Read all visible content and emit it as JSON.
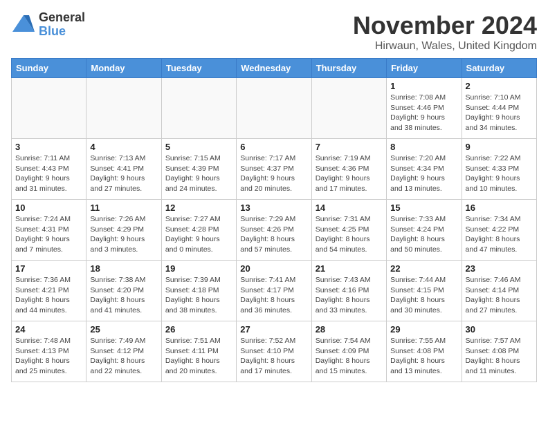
{
  "logo": {
    "general": "General",
    "blue": "Blue"
  },
  "title": "November 2024",
  "subtitle": "Hirwaun, Wales, United Kingdom",
  "days_of_week": [
    "Sunday",
    "Monday",
    "Tuesday",
    "Wednesday",
    "Thursday",
    "Friday",
    "Saturday"
  ],
  "weeks": [
    [
      {
        "day": "",
        "info": "",
        "empty": true
      },
      {
        "day": "",
        "info": "",
        "empty": true
      },
      {
        "day": "",
        "info": "",
        "empty": true
      },
      {
        "day": "",
        "info": "",
        "empty": true
      },
      {
        "day": "",
        "info": "",
        "empty": true
      },
      {
        "day": "1",
        "info": "Sunrise: 7:08 AM\nSunset: 4:46 PM\nDaylight: 9 hours and 38 minutes."
      },
      {
        "day": "2",
        "info": "Sunrise: 7:10 AM\nSunset: 4:44 PM\nDaylight: 9 hours and 34 minutes."
      }
    ],
    [
      {
        "day": "3",
        "info": "Sunrise: 7:11 AM\nSunset: 4:43 PM\nDaylight: 9 hours and 31 minutes."
      },
      {
        "day": "4",
        "info": "Sunrise: 7:13 AM\nSunset: 4:41 PM\nDaylight: 9 hours and 27 minutes."
      },
      {
        "day": "5",
        "info": "Sunrise: 7:15 AM\nSunset: 4:39 PM\nDaylight: 9 hours and 24 minutes."
      },
      {
        "day": "6",
        "info": "Sunrise: 7:17 AM\nSunset: 4:37 PM\nDaylight: 9 hours and 20 minutes."
      },
      {
        "day": "7",
        "info": "Sunrise: 7:19 AM\nSunset: 4:36 PM\nDaylight: 9 hours and 17 minutes."
      },
      {
        "day": "8",
        "info": "Sunrise: 7:20 AM\nSunset: 4:34 PM\nDaylight: 9 hours and 13 minutes."
      },
      {
        "day": "9",
        "info": "Sunrise: 7:22 AM\nSunset: 4:33 PM\nDaylight: 9 hours and 10 minutes."
      }
    ],
    [
      {
        "day": "10",
        "info": "Sunrise: 7:24 AM\nSunset: 4:31 PM\nDaylight: 9 hours and 7 minutes."
      },
      {
        "day": "11",
        "info": "Sunrise: 7:26 AM\nSunset: 4:29 PM\nDaylight: 9 hours and 3 minutes."
      },
      {
        "day": "12",
        "info": "Sunrise: 7:27 AM\nSunset: 4:28 PM\nDaylight: 9 hours and 0 minutes."
      },
      {
        "day": "13",
        "info": "Sunrise: 7:29 AM\nSunset: 4:26 PM\nDaylight: 8 hours and 57 minutes."
      },
      {
        "day": "14",
        "info": "Sunrise: 7:31 AM\nSunset: 4:25 PM\nDaylight: 8 hours and 54 minutes."
      },
      {
        "day": "15",
        "info": "Sunrise: 7:33 AM\nSunset: 4:24 PM\nDaylight: 8 hours and 50 minutes."
      },
      {
        "day": "16",
        "info": "Sunrise: 7:34 AM\nSunset: 4:22 PM\nDaylight: 8 hours and 47 minutes."
      }
    ],
    [
      {
        "day": "17",
        "info": "Sunrise: 7:36 AM\nSunset: 4:21 PM\nDaylight: 8 hours and 44 minutes."
      },
      {
        "day": "18",
        "info": "Sunrise: 7:38 AM\nSunset: 4:20 PM\nDaylight: 8 hours and 41 minutes."
      },
      {
        "day": "19",
        "info": "Sunrise: 7:39 AM\nSunset: 4:18 PM\nDaylight: 8 hours and 38 minutes."
      },
      {
        "day": "20",
        "info": "Sunrise: 7:41 AM\nSunset: 4:17 PM\nDaylight: 8 hours and 36 minutes."
      },
      {
        "day": "21",
        "info": "Sunrise: 7:43 AM\nSunset: 4:16 PM\nDaylight: 8 hours and 33 minutes."
      },
      {
        "day": "22",
        "info": "Sunrise: 7:44 AM\nSunset: 4:15 PM\nDaylight: 8 hours and 30 minutes."
      },
      {
        "day": "23",
        "info": "Sunrise: 7:46 AM\nSunset: 4:14 PM\nDaylight: 8 hours and 27 minutes."
      }
    ],
    [
      {
        "day": "24",
        "info": "Sunrise: 7:48 AM\nSunset: 4:13 PM\nDaylight: 8 hours and 25 minutes."
      },
      {
        "day": "25",
        "info": "Sunrise: 7:49 AM\nSunset: 4:12 PM\nDaylight: 8 hours and 22 minutes."
      },
      {
        "day": "26",
        "info": "Sunrise: 7:51 AM\nSunset: 4:11 PM\nDaylight: 8 hours and 20 minutes."
      },
      {
        "day": "27",
        "info": "Sunrise: 7:52 AM\nSunset: 4:10 PM\nDaylight: 8 hours and 17 minutes."
      },
      {
        "day": "28",
        "info": "Sunrise: 7:54 AM\nSunset: 4:09 PM\nDaylight: 8 hours and 15 minutes."
      },
      {
        "day": "29",
        "info": "Sunrise: 7:55 AM\nSunset: 4:08 PM\nDaylight: 8 hours and 13 minutes."
      },
      {
        "day": "30",
        "info": "Sunrise: 7:57 AM\nSunset: 4:08 PM\nDaylight: 8 hours and 11 minutes."
      }
    ]
  ]
}
